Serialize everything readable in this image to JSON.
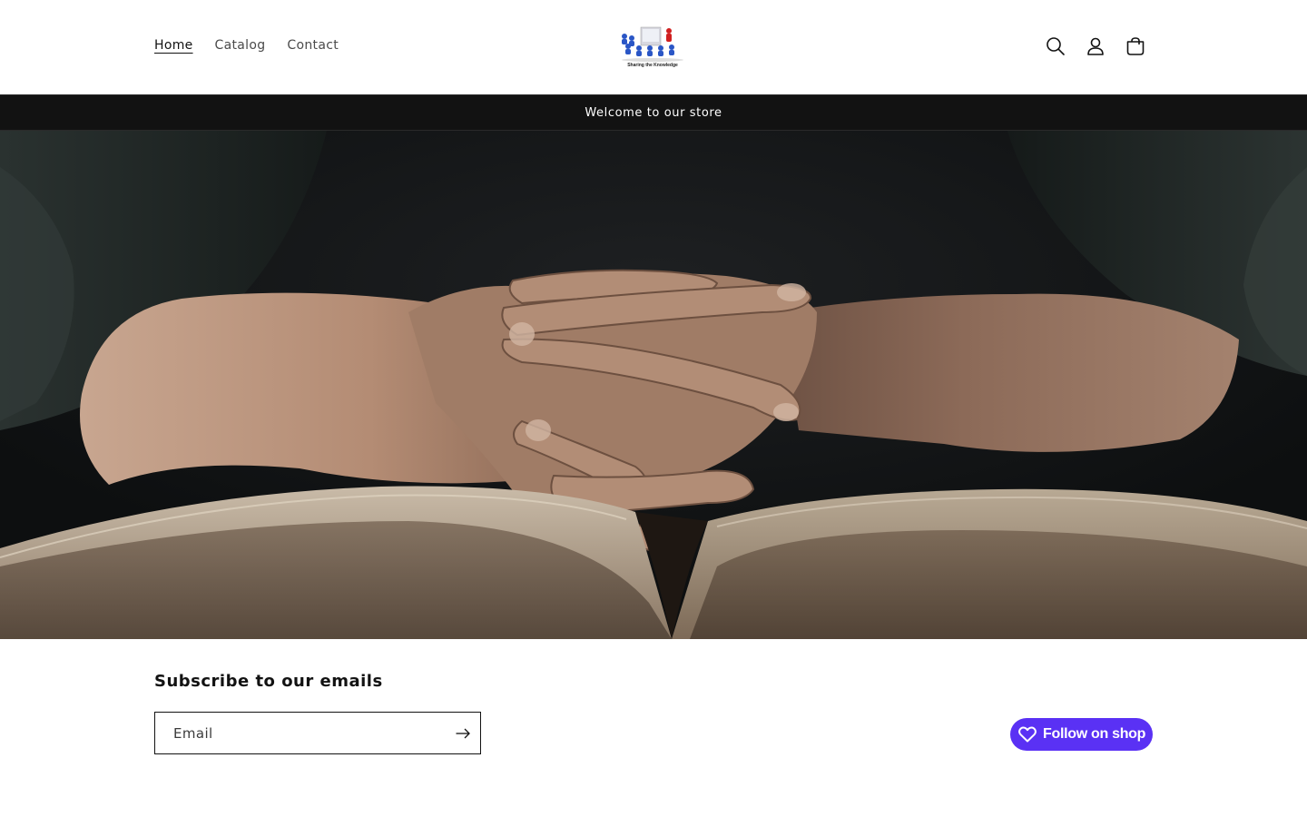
{
  "header": {
    "nav": [
      {
        "label": "Home",
        "active": true
      },
      {
        "label": "Catalog",
        "active": false
      },
      {
        "label": "Contact",
        "active": false
      }
    ],
    "logo": {
      "caption": "Sharing the Knowledge"
    },
    "icons": [
      "search-icon",
      "account-icon",
      "cart-icon"
    ]
  },
  "announcement": {
    "text": "Welcome to our store"
  },
  "hero": {
    "image": "hands-clasped-over-open-book"
  },
  "subscribe": {
    "title": "Subscribe to our emails",
    "email_placeholder": "Email",
    "email_value": ""
  },
  "shop": {
    "follow_label": "Follow on shop",
    "color": "#5a31f4"
  },
  "colors": {
    "announcement_bg": "#121212",
    "text": "#121212"
  }
}
